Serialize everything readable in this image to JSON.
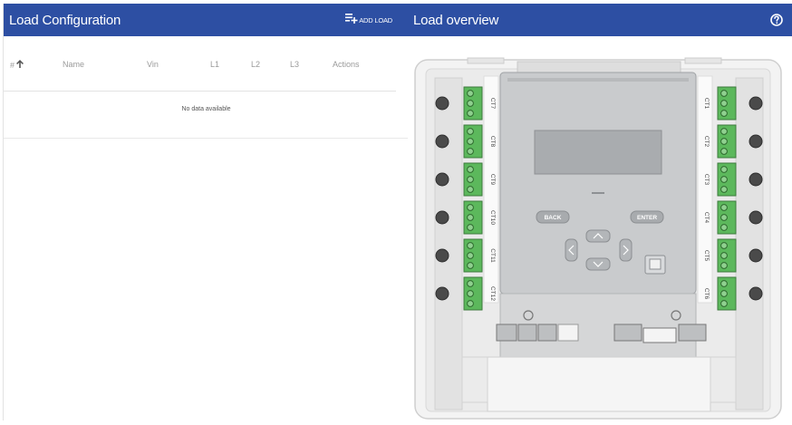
{
  "load_config": {
    "title": "Load Configuration",
    "add_load_label": "ADD LOAD",
    "columns": [
      "#",
      "Name",
      "Vin",
      "L1",
      "L2",
      "L3",
      "Actions"
    ],
    "empty_text": "No data available"
  },
  "load_overview": {
    "title": "Load overview",
    "ct_left": [
      "CT7",
      "CT8",
      "CT9",
      "CT10",
      "CT11",
      "CT12"
    ],
    "ct_right": [
      "CT1",
      "CT2",
      "CT3",
      "CT4",
      "CT5",
      "CT6"
    ],
    "back_label": "BACK",
    "enter_label": "ENTER"
  },
  "colors": {
    "header_bg": "#2d4fa3",
    "terminal_green": "#5cb85c"
  }
}
